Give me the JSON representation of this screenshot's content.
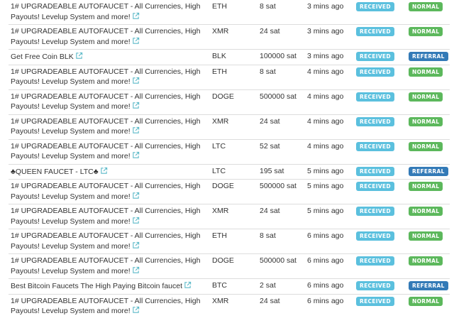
{
  "colors": {
    "received": "#5bc0de",
    "normal": "#5cb85c",
    "referral": "#337ab7",
    "link_icon": "#5bb9c8"
  },
  "icon_names": {
    "external_link": "external-link-icon"
  },
  "rows": [
    {
      "faucet": "1# UPGRADEABLE AUTOFAUCET - All Currencies, High Payouts! Levelup System and more!",
      "currency": "ETH",
      "amount": "8 sat",
      "time": "3 mins ago",
      "status": "RECEIVED",
      "type": "NORMAL"
    },
    {
      "faucet": "1# UPGRADEABLE AUTOFAUCET - All Currencies, High Payouts! Levelup System and more!",
      "currency": "XMR",
      "amount": "24 sat",
      "time": "3 mins ago",
      "status": "RECEIVED",
      "type": "NORMAL"
    },
    {
      "faucet": "Get Free Coin BLK",
      "currency": "BLK",
      "amount": "100000 sat",
      "time": "3 mins ago",
      "status": "RECEIVED",
      "type": "REFERRAL"
    },
    {
      "faucet": "1# UPGRADEABLE AUTOFAUCET - All Currencies, High Payouts! Levelup System and more!",
      "currency": "ETH",
      "amount": "8 sat",
      "time": "4 mins ago",
      "status": "RECEIVED",
      "type": "NORMAL"
    },
    {
      "faucet": "1# UPGRADEABLE AUTOFAUCET - All Currencies, High Payouts! Levelup System and more!",
      "currency": "DOGE",
      "amount": "500000 sat",
      "time": "4 mins ago",
      "status": "RECEIVED",
      "type": "NORMAL"
    },
    {
      "faucet": "1# UPGRADEABLE AUTOFAUCET - All Currencies, High Payouts! Levelup System and more!",
      "currency": "XMR",
      "amount": "24 sat",
      "time": "4 mins ago",
      "status": "RECEIVED",
      "type": "NORMAL"
    },
    {
      "faucet": "1# UPGRADEABLE AUTOFAUCET - All Currencies, High Payouts! Levelup System and more!",
      "currency": "LTC",
      "amount": "52 sat",
      "time": "4 mins ago",
      "status": "RECEIVED",
      "type": "NORMAL"
    },
    {
      "faucet": "♣QUEEN FAUCET - LTC♣",
      "currency": "LTC",
      "amount": "195 sat",
      "time": "5 mins ago",
      "status": "RECEIVED",
      "type": "REFERRAL"
    },
    {
      "faucet": "1# UPGRADEABLE AUTOFAUCET - All Currencies, High Payouts! Levelup System and more!",
      "currency": "DOGE",
      "amount": "500000 sat",
      "time": "5 mins ago",
      "status": "RECEIVED",
      "type": "NORMAL"
    },
    {
      "faucet": "1# UPGRADEABLE AUTOFAUCET - All Currencies, High Payouts! Levelup System and more!",
      "currency": "XMR",
      "amount": "24 sat",
      "time": "5 mins ago",
      "status": "RECEIVED",
      "type": "NORMAL"
    },
    {
      "faucet": "1# UPGRADEABLE AUTOFAUCET - All Currencies, High Payouts! Levelup System and more!",
      "currency": "ETH",
      "amount": "8 sat",
      "time": "6 mins ago",
      "status": "RECEIVED",
      "type": "NORMAL"
    },
    {
      "faucet": "1# UPGRADEABLE AUTOFAUCET - All Currencies, High Payouts! Levelup System and more!",
      "currency": "DOGE",
      "amount": "500000 sat",
      "time": "6 mins ago",
      "status": "RECEIVED",
      "type": "NORMAL"
    },
    {
      "faucet": "Best Bitcoin Faucets The High Paying Bitcoin faucet",
      "currency": "BTC",
      "amount": "2 sat",
      "time": "6 mins ago",
      "status": "RECEIVED",
      "type": "REFERRAL"
    },
    {
      "faucet": "1# UPGRADEABLE AUTOFAUCET - All Currencies, High Payouts! Levelup System and more!",
      "currency": "XMR",
      "amount": "24 sat",
      "time": "6 mins ago",
      "status": "RECEIVED",
      "type": "NORMAL"
    }
  ]
}
